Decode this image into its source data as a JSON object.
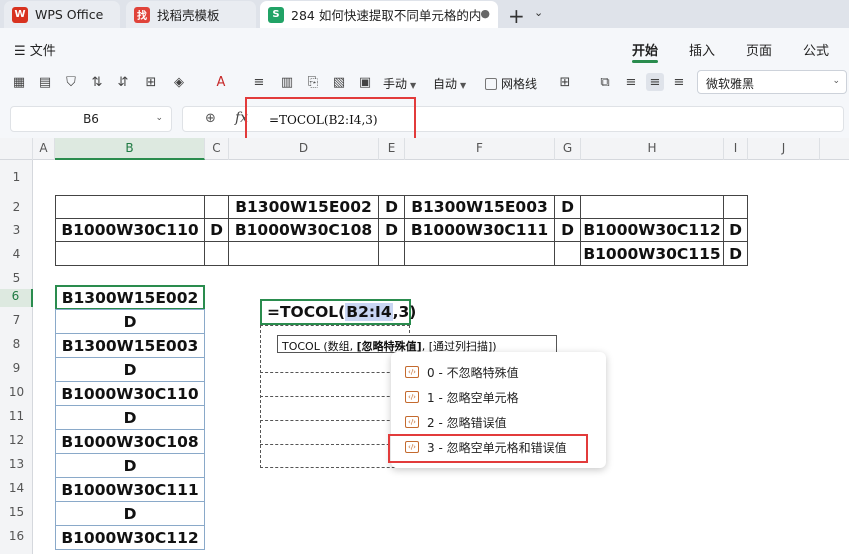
{
  "tabs": {
    "wps": "WPS Office",
    "template": "找稻壳模板",
    "document": "284 如何快速提取不同单元格的内"
  },
  "menu": {
    "file": "文件",
    "items": [
      "开始",
      "插入",
      "页面",
      "公式"
    ]
  },
  "toolbar": {
    "manual": "手动",
    "auto": "自动",
    "gridlines": "网格线",
    "font": "微软雅黑"
  },
  "formula_bar": {
    "name_box": "B6",
    "fx": "fx",
    "formula": "=TOCOL(B2:I4,3)"
  },
  "columns": [
    "A",
    "B",
    "C",
    "D",
    "E",
    "F",
    "G",
    "H",
    "I",
    "J"
  ],
  "rows": [
    "1",
    "2",
    "3",
    "4",
    "5",
    "6",
    "7",
    "8",
    "9",
    "10",
    "11",
    "12",
    "13",
    "14",
    "15",
    "16"
  ],
  "table": {
    "r2": [
      "B1300W15E002",
      "D",
      "B1300W15E003",
      "D"
    ],
    "r3": [
      "B1000W30C110",
      "D",
      "B1000W30C108",
      "D",
      "B1000W30C111",
      "D",
      "B1000W30C112",
      "D"
    ],
    "r4": [
      "B1000W30C115",
      "D"
    ]
  },
  "result": [
    "B1300W15E002",
    "D",
    "B1300W15E003",
    "D",
    "B1000W30C110",
    "D",
    "B1000W30C108",
    "D",
    "B1000W30C111",
    "D",
    "B1000W30C112"
  ],
  "editing_cell": {
    "prefix": "=TOCOL(",
    "ref": "B2:I4",
    "suffix": ",3)"
  },
  "hint": {
    "fn": "TOCOL (数组, ",
    "bold": "[忽略特殊值]",
    "rest": ", [通过列扫描])"
  },
  "dropdown": [
    "0 - 不忽略特殊值",
    "1 - 忽略空单元格",
    "2 - 忽略错误值",
    "3 - 忽略空单元格和错误值"
  ],
  "colors": {
    "accent": "#2a8c4e",
    "annotation": "#e23b3b",
    "wps_red": "#d8321f",
    "template_red": "#e0433a",
    "sheet_green": "#21a366"
  }
}
